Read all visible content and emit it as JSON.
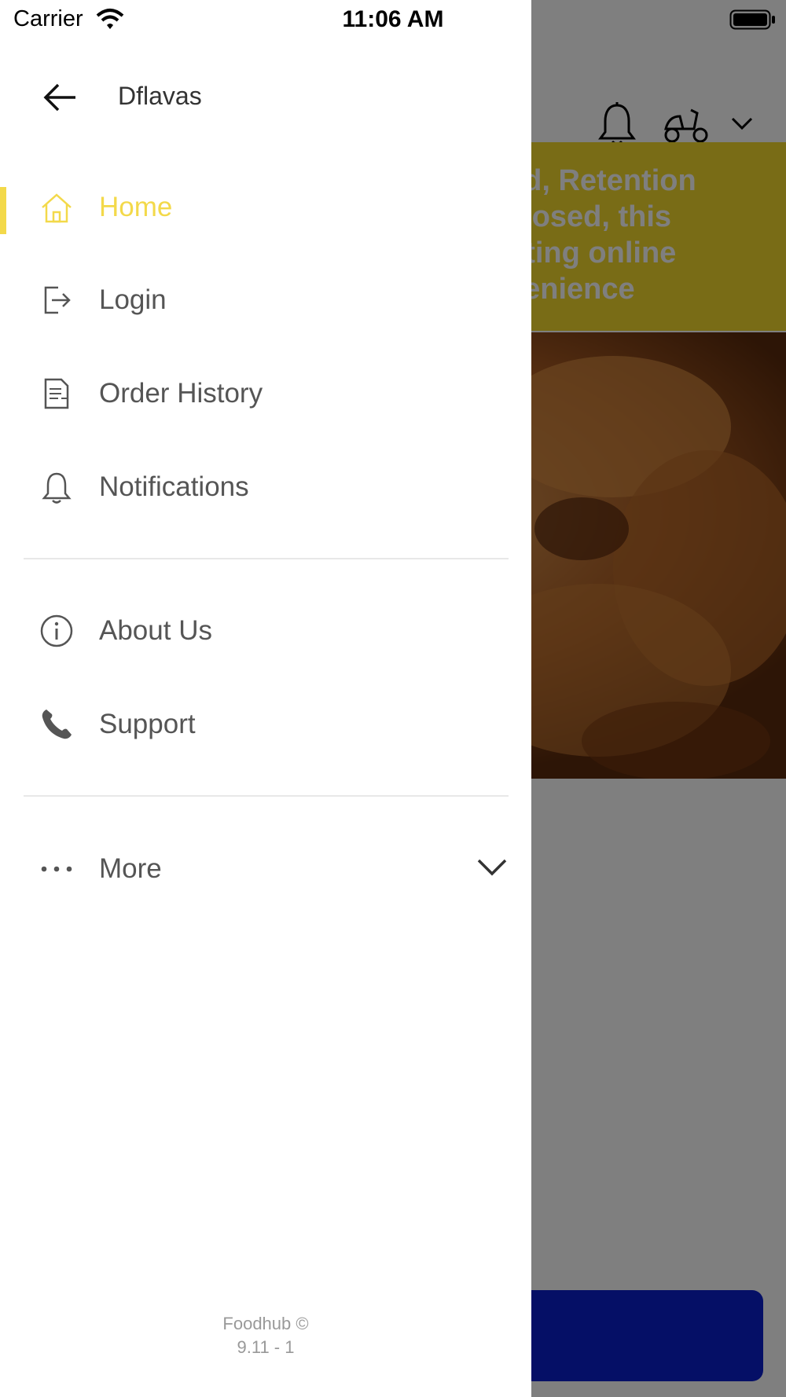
{
  "status_bar": {
    "carrier": "Carrier",
    "time": "11:06 AM"
  },
  "background": {
    "banner_text": "ed, Retention\nclosed, this\npting online\nvenience",
    "colors": {
      "banner": "#f3d92c",
      "button": "#0a1fcc"
    }
  },
  "drawer": {
    "restaurant_name": "Dflavas",
    "items": [
      {
        "label": "Home",
        "icon": "home-icon",
        "active": true
      },
      {
        "label": "Login",
        "icon": "login-icon"
      },
      {
        "label": "Order History",
        "icon": "order-history-icon"
      },
      {
        "label": "Notifications",
        "icon": "bell-icon"
      },
      {
        "label": "About Us",
        "icon": "info-icon"
      },
      {
        "label": "Support",
        "icon": "phone-icon"
      },
      {
        "label": "More",
        "icon": "more-dots-icon"
      }
    ],
    "footer_line1": "Foodhub ©",
    "footer_line2": "9.11 - 1",
    "accent_color": "#f3d94a"
  }
}
